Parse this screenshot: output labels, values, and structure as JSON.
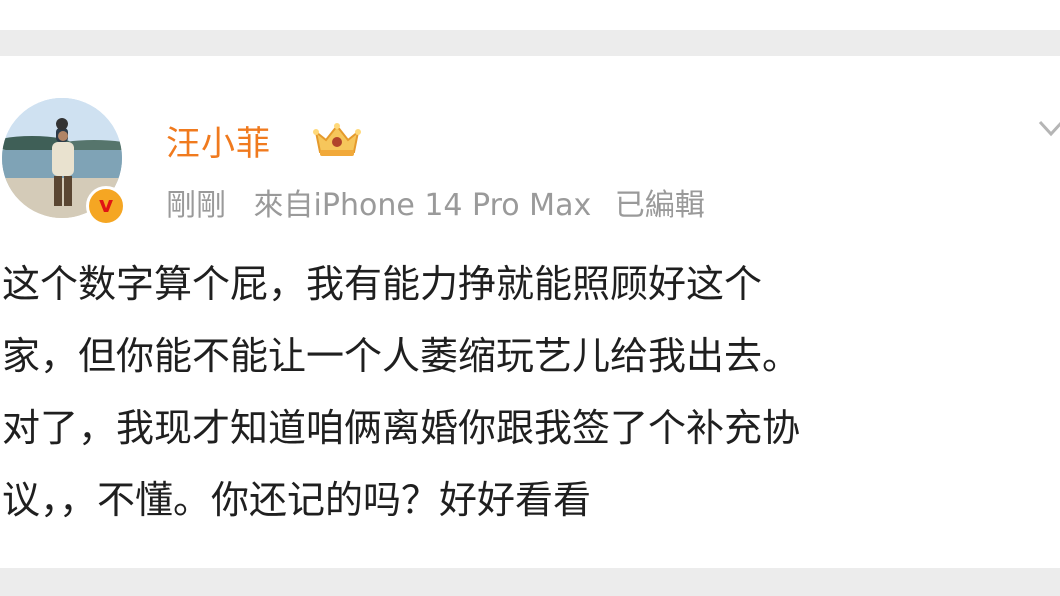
{
  "post": {
    "username": "汪小菲",
    "time": "剛剛",
    "source": "來自iPhone 14 Pro Max",
    "edited": "已編輯",
    "body_lines": [
      "这个数字算个屁，我有能力挣就能照顾好这个",
      "家，但你能不能让一个人萎缩玩艺儿给我出去。",
      "对了，我现才知道咱俩离婚你跟我签了个补充协",
      "议，，不懂。你还记的吗？好好看看"
    ]
  },
  "icons": {
    "verified": "verified-v-icon",
    "vip": "crown-icon",
    "more": "chevron-down-icon"
  },
  "colors": {
    "username": "#f07a1e",
    "meta": "#9a9a9a",
    "body": "#1f1f1f",
    "badge": "#f5a623"
  }
}
